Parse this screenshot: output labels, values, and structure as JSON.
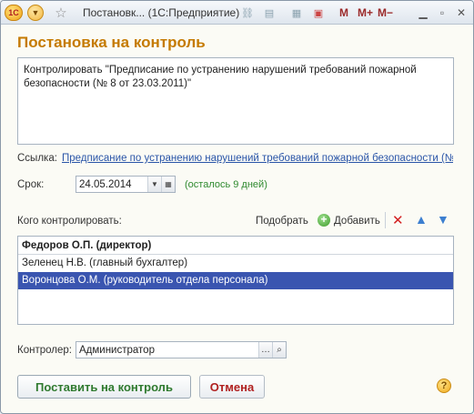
{
  "titlebar": {
    "app_badge": "1С",
    "menu_icon": "chevron-down-icon",
    "favorite_icon": "star-icon",
    "title": "Постановк... (1С:Предприятие)",
    "m_buttons": [
      "M",
      "M+",
      "M−"
    ],
    "controls": [
      "minimize-icon",
      "restore-icon",
      "close-icon"
    ]
  },
  "form": {
    "title": "Постановка на контроль",
    "memo_text": "Контролировать \"Предписание по устранению нарушений требований пожарной безопасности (№ 8 от 23.03.2011)\""
  },
  "link_row": {
    "label": "Ссылка:",
    "value": "Предписание по устранению нарушений требований пожарной безопасности (№ 8..."
  },
  "deadline": {
    "label": "Срок:",
    "value": "24.05.2014",
    "remaining": "(осталось 9 дней)"
  },
  "whom": {
    "label": "Кого контролировать:",
    "pick_label": "Подобрать",
    "add_label": "Добавить",
    "rows": [
      "Федоров О.П. (директор)",
      "Зеленец Н.В. (главный бухгалтер)",
      "Воронцова О.М. (руководитель отдела персонала)"
    ]
  },
  "controller": {
    "label": "Контролер:",
    "value": "Администратор"
  },
  "buttons": {
    "submit": "Поставить на контроль",
    "cancel": "Отмена",
    "help": "?"
  },
  "colors": {
    "title_orange": "#c57a00",
    "link_blue": "#2a55a8",
    "remaining_green": "#2f8a2f",
    "selection_blue": "#3a55b0",
    "cancel_red": "#b02020"
  }
}
